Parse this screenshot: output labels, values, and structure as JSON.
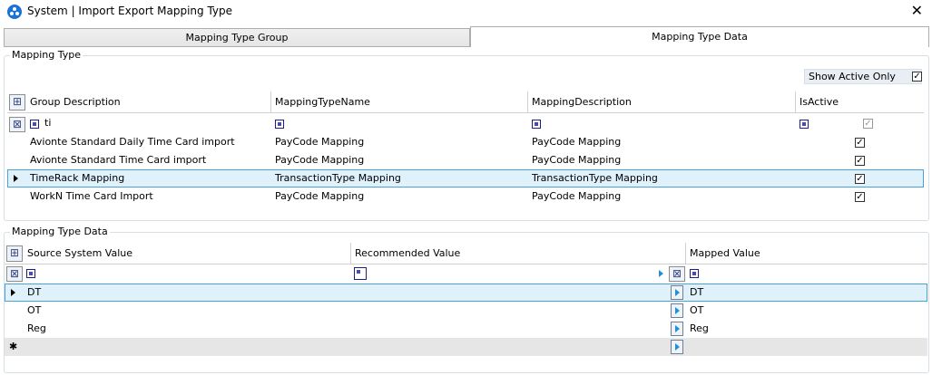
{
  "window": {
    "title": "System | Import Export Mapping Type",
    "close_symbol": "✕"
  },
  "tabs": [
    {
      "label": "Mapping Type Group"
    },
    {
      "label": "Mapping Type Data"
    }
  ],
  "mapping_type": {
    "legend": "Mapping Type",
    "show_active_label": "Show Active Only",
    "show_active_checked": true,
    "columns": [
      "Group Description",
      "MappingTypeName",
      "MappingDescription",
      "IsActive"
    ],
    "filter": {
      "group_description": "ti"
    },
    "rows": [
      {
        "group": "Avionte Standard Daily Time Card import",
        "name": "PayCode Mapping",
        "desc": "PayCode Mapping",
        "active": true
      },
      {
        "group": "Avionte Standard Time Card import",
        "name": "PayCode Mapping",
        "desc": "PayCode Mapping",
        "active": true
      },
      {
        "group": "TimeRack Mapping",
        "name": "TransactionType Mapping",
        "desc": "TransactionType Mapping",
        "active": true,
        "selected": true
      },
      {
        "group": "WorkN Time Card Import",
        "name": "PayCode Mapping",
        "desc": "PayCode Mapping",
        "active": true
      }
    ]
  },
  "mapping_data": {
    "legend": "Mapping Type Data",
    "columns": [
      "Source System Value",
      "Recommended Value",
      "Mapped Value"
    ],
    "rows": [
      {
        "source": "DT",
        "recommended": "",
        "mapped": "DT",
        "selected": true
      },
      {
        "source": "OT",
        "recommended": "",
        "mapped": "OT"
      },
      {
        "source": "Reg",
        "recommended": "",
        "mapped": "Reg"
      }
    ],
    "new_row_symbol": "✱"
  },
  "icons": {
    "check": "✓",
    "corner_grid": "⊞",
    "corner_filter": "⊠"
  }
}
